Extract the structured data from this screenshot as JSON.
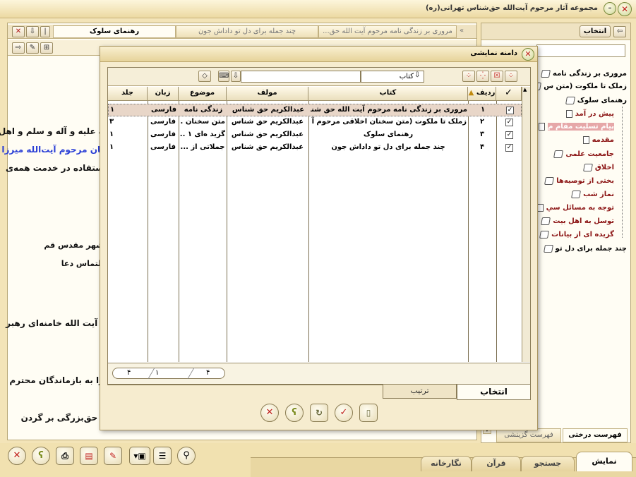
{
  "window": {
    "title": "مجموعه آثار مرحوم آيت‌الله حق‌شناس تهرانى(ره)"
  },
  "doc_tabs": [
    {
      "label": "رهنماى سلوک"
    },
    {
      "label": "مرورى بر زندگى نامه مرحوم آيت الله حق..."
    },
    {
      "label": "چند جمله براى دل تو داداش جون"
    }
  ],
  "document_lines": [
    "ه عليه و آله و سلم و اهل",
    "نان مرحوم آيت‌الله ميرزا",
    "ستفاده در خدمت همه‌ى",
    "شهر مقدس قم",
    "التماس دعا",
    "، آيت الله خامنه‌اى رهبر",
    "را به بازماندگان محترم",
    "، حق‌بزرگى بر گردن"
  ],
  "right_panel": {
    "select_button": "انتخاب",
    "tabs": [
      {
        "label": "فهرست درختى"
      },
      {
        "label": "فهرست گزينشى"
      }
    ]
  },
  "tree": [
    {
      "label": "مرورى بر زندگى نامه"
    },
    {
      "label": "زملک تا ملکوت (متن س"
    },
    {
      "label": "رهنماى سلوک"
    },
    {
      "label": "پيش در آمد"
    },
    {
      "label": "پيام تسليت مقام م"
    },
    {
      "label": "مقدمه"
    },
    {
      "label": "جامعيت علمى"
    },
    {
      "label": "اخلاق"
    },
    {
      "label": "بختى از توصيه‌ها"
    },
    {
      "label": "نماز شب"
    },
    {
      "label": "توجه به مسائل سي"
    },
    {
      "label": "توسل به اهل بيت"
    },
    {
      "label": "گزيده اى از بيانات"
    },
    {
      "label": "چند جمله براى دل تو"
    }
  ],
  "dialog": {
    "title": "دامنه نمايشى",
    "filter_label": "کتاب",
    "columns": [
      "رديف",
      "کتاب",
      "مولف",
      "موضوع",
      "زبان",
      "جلد"
    ],
    "rows": [
      {
        "index": "۱",
        "book": "مرورى بر زندگى نامه مرحوم آيت الله حق شناس",
        "author": "عبدالکريم حق شناس",
        "subject": "زندگى نامه",
        "language": "فارسى",
        "volume": "۱"
      },
      {
        "index": "۲",
        "book": "زملک تا ملکوت (متن سخنان اخلاقى مرحوم آ ...",
        "author": "عبدالکريم حق شناس",
        "subject": "متن سخنان ...",
        "language": "فارسى",
        "volume": "۳"
      },
      {
        "index": "۳",
        "book": "رهنماى سلوک",
        "author": "عبدالکريم حق شناس",
        "subject": "گزيد ه‌اى ۱ ...",
        "language": "فارسى",
        "volume": "۱"
      },
      {
        "index": "۴",
        "book": "چند جمله براى دل تو داداش جون",
        "author": "عبدالکريم حق شناس",
        "subject": "جملاتى از ...",
        "language": "فارسى",
        "volume": "۱"
      }
    ],
    "pager": {
      "a": "۴",
      "b": "۱",
      "c": "۴"
    },
    "tabs": [
      {
        "label": "انتخاب"
      },
      {
        "label": "ترتيب"
      }
    ]
  },
  "bottom_tabs": [
    {
      "label": "نمايش"
    },
    {
      "label": "جستجو"
    },
    {
      "label": "قرآن"
    },
    {
      "label": "نگارخانه"
    }
  ],
  "colors": {
    "accent_red": "#c0201c",
    "tree_red": "#8b1414",
    "highlight": "#e6a7a8",
    "link_blue": "#2a3fd6"
  }
}
